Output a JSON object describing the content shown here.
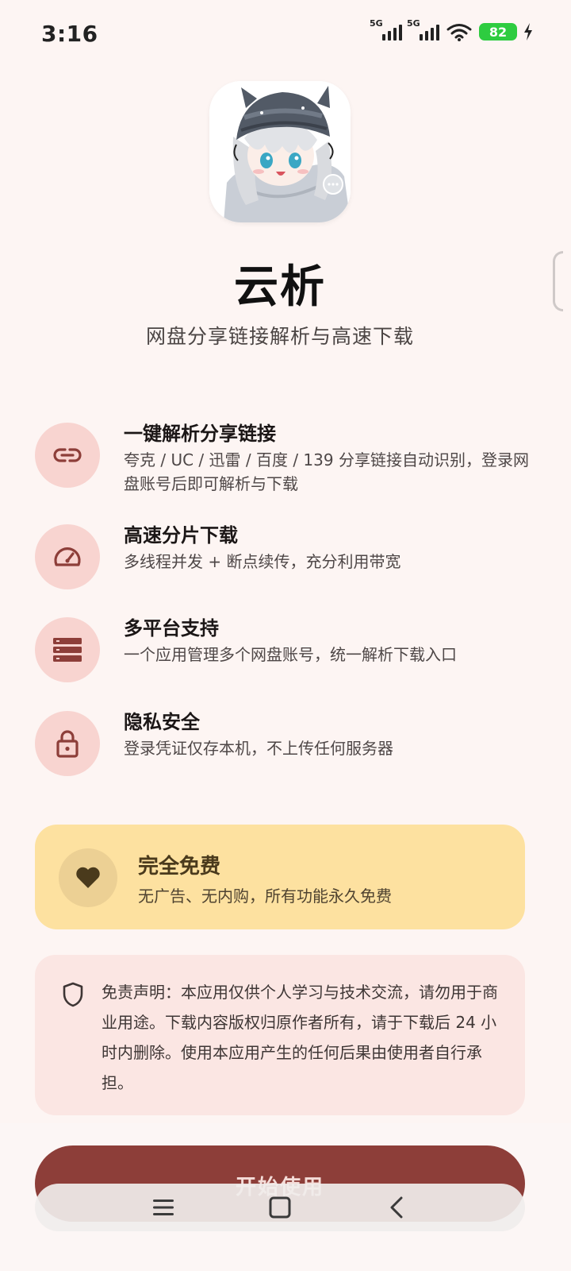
{
  "status_bar": {
    "time": "3:16",
    "signal_1_label": "5G",
    "signal_2_label": "5G",
    "battery": "82"
  },
  "app": {
    "name": "云析",
    "subtitle": "网盘分享链接解析与高速下载"
  },
  "features": [
    {
      "icon": "link-icon",
      "title": "一键解析分享链接",
      "desc": "夸克 / UC / 迅雷 / 百度 / 139 分享链接自动识别，登录网盘账号后即可解析与下载"
    },
    {
      "icon": "speedometer-icon",
      "title": "高速分片下载",
      "desc": "多线程并发 + 断点续传，充分利用带宽"
    },
    {
      "icon": "storage-icon",
      "title": "多平台支持",
      "desc": "一个应用管理多个网盘账号，统一解析下载入口"
    },
    {
      "icon": "lock-icon",
      "title": "隐私安全",
      "desc": "登录凭证仅存本机，不上传任何服务器"
    }
  ],
  "free_card": {
    "icon": "heart-icon",
    "title": "完全免费",
    "desc": "无广告、无内购，所有功能永久免费"
  },
  "disclaimer": {
    "icon": "shield-icon",
    "text": "免责声明：本应用仅供个人学习与技术交流，请勿用于商业用途。下载内容版权归原作者所有，请于下载后 24 小时内删除。使用本应用产生的任何后果由使用者自行承担。"
  },
  "start_button": {
    "label": "开始使用"
  },
  "nav": {
    "menu_icon": "menu-icon",
    "home_icon": "home-icon",
    "back_icon": "back-icon"
  },
  "colors": {
    "background": "#fdf5f3",
    "feature_circle": "#f8d4d0",
    "icon_tint": "#8d3e39",
    "free_card": "#fde1a0",
    "disclaimer_bg": "#fbe6e3",
    "primary_button": "#8d3e39",
    "battery": "#2ecc40"
  }
}
